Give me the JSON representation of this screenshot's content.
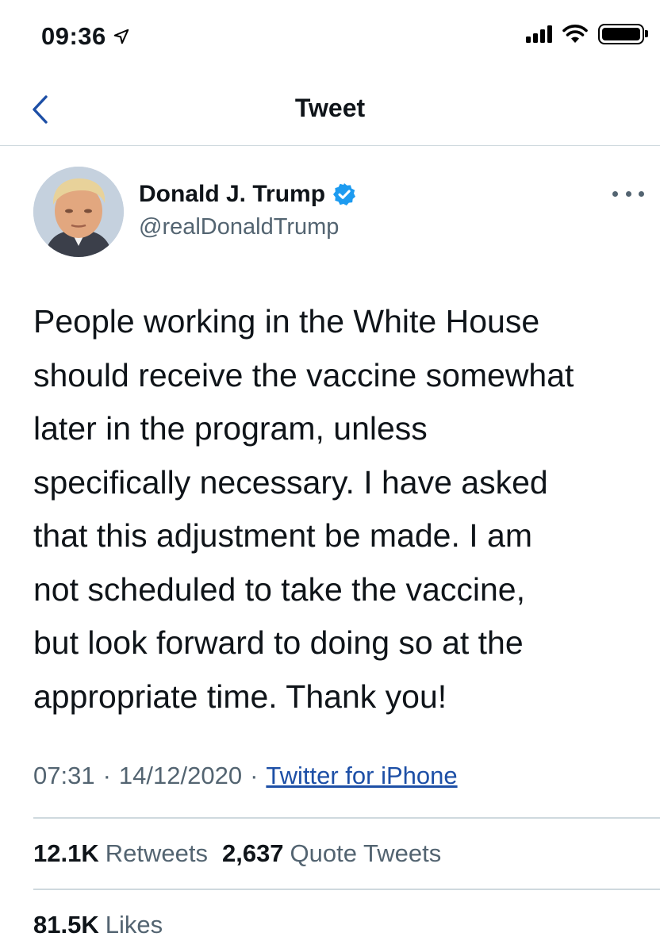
{
  "status_bar": {
    "time": "09:36",
    "icons": [
      "location-arrow-icon",
      "signal-icon",
      "wifi-icon",
      "battery-icon"
    ]
  },
  "nav": {
    "title": "Tweet",
    "back_icon": "chevron-left-icon"
  },
  "tweet": {
    "author": {
      "display_name": "Donald J. Trump",
      "handle": "@realDonaldTrump",
      "verified": true
    },
    "text": "People working in the White House\nshould receive the vaccine somewhat\nlater in the program, unless\nspecifically necessary. I have asked\nthat this adjustment be made. I am\nnot scheduled to take the vaccine,\nbut look forward to doing so at the\nappropriate time. Thank you!",
    "time": "07:31",
    "separator": "·",
    "date": "14/12/2020",
    "source": "Twitter for iPhone",
    "stats": {
      "retweets_count": "12.1K",
      "retweets_label": "Retweets",
      "quote_count": "2,637",
      "quote_label": "Quote Tweets",
      "likes_count": "81.5K",
      "likes_label": "Likes"
    }
  },
  "colors": {
    "accent": "#1d9bf0",
    "link": "#1d4fa6",
    "secondary_text": "#536471",
    "divider": "#cfd9de"
  }
}
